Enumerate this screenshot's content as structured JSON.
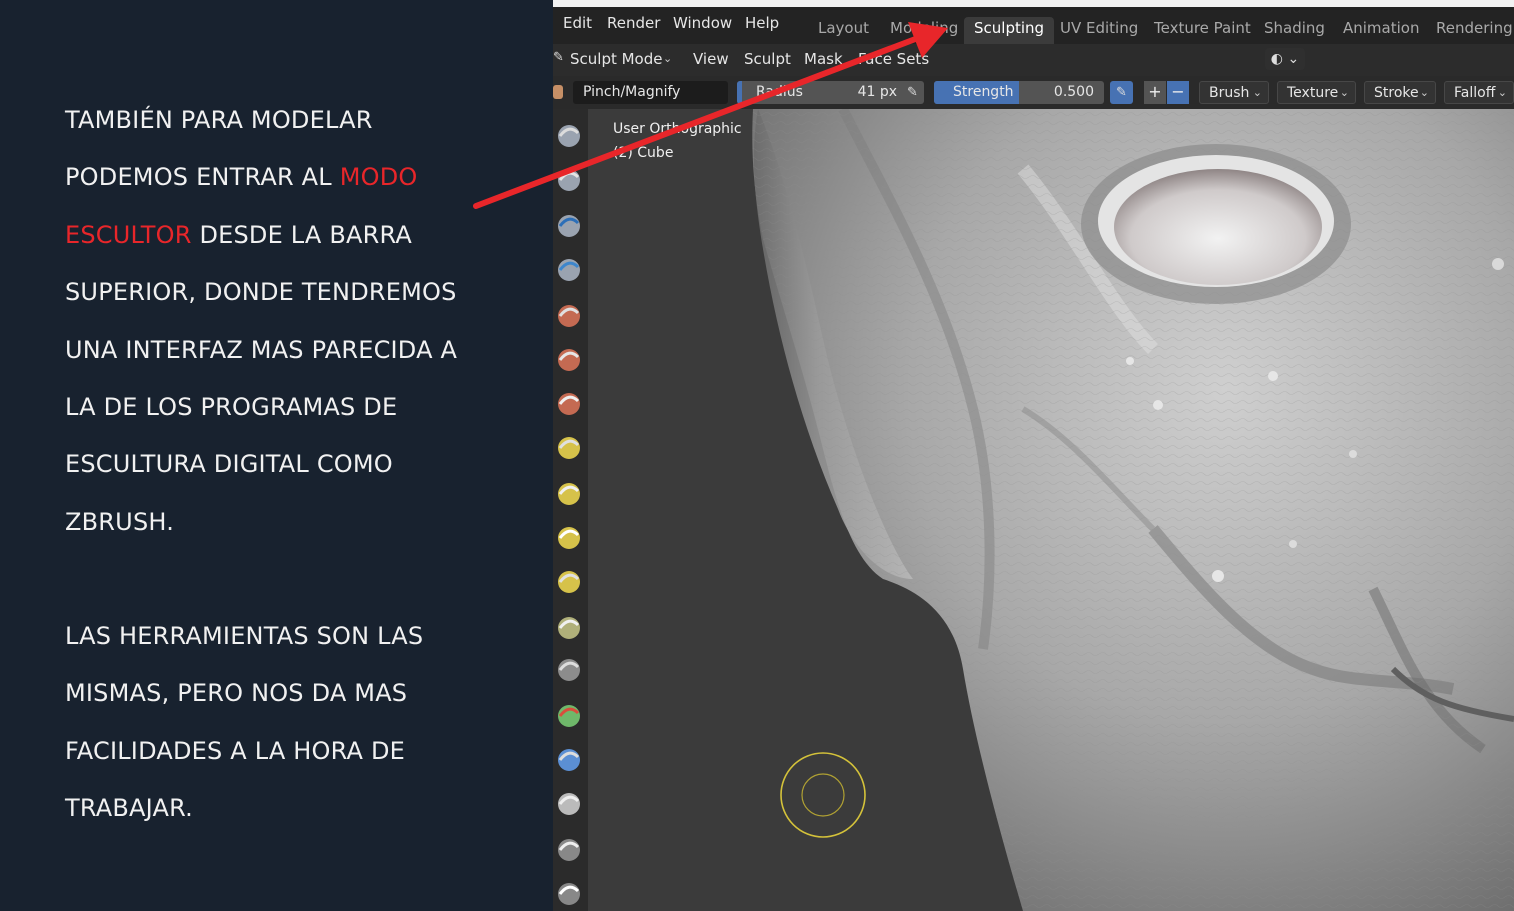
{
  "slide": {
    "paragraph1": {
      "l1": "TAMBIÉN PARA MODELAR",
      "l2a": "PODEMOS ENTRAR AL ",
      "l2b": "MODO",
      "l3a": "ESCULTOR",
      "l3b": " DESDE LA BARRA",
      "l4": "SUPERIOR, DONDE TENDREMOS",
      "l5": "UNA INTERFAZ MAS PARECIDA A",
      "l6": "LA DE LOS PROGRAMAS DE",
      "l7": "ESCULTURA DIGITAL COMO",
      "l8": "ZBRUSH."
    },
    "paragraph2": {
      "l1": "LAS HERRAMIENTAS SON LAS",
      "l2": "MISMAS, PERO NOS DA MAS",
      "l3": "FACILIDADES A LA HORA DE",
      "l4": "TRABAJAR."
    },
    "highlight_color": "#e8262a",
    "arrow_color": "#e8262a"
  },
  "blender": {
    "menu": [
      "Edit",
      "Render",
      "Window",
      "Help"
    ],
    "workspaces": [
      "Layout",
      "Modeling",
      "Sculpting",
      "UV Editing",
      "Texture Paint",
      "Shading",
      "Animation",
      "Rendering"
    ],
    "active_workspace": "Sculpting",
    "header": {
      "mode": "Sculpt Mode",
      "view": "View",
      "sculpt": "Sculpt",
      "mask": "Mask",
      "face_sets": "Face Sets"
    },
    "tool_settings": {
      "brush": "Pinch/Magnify",
      "radius_label": "Radius",
      "radius_value": "41 px",
      "strength_label": "Strength",
      "strength_value": "0.500",
      "strength_fraction": 0.5,
      "plus": "+",
      "minus": "−",
      "dropdowns": [
        "Brush",
        "Texture",
        "Stroke",
        "Falloff"
      ]
    },
    "viewport": {
      "view_name": "User Orthographic",
      "object": "(2) Cube"
    },
    "tools": [
      "draw-icon",
      "draw-sharp-icon",
      "clay-icon",
      "clay-strips-icon",
      "clay-thumb-icon",
      "layer-icon",
      "inflate-icon",
      "blob-icon",
      "crease-icon",
      "smooth-icon",
      "flatten-icon",
      "fill-icon",
      "scrape-icon",
      "multiplane-scrape-icon",
      "pinch-icon",
      "grab-icon",
      "elastic-deform-icon",
      "snake-hook-icon",
      "box-mask-icon",
      "annotate-icon"
    ]
  }
}
